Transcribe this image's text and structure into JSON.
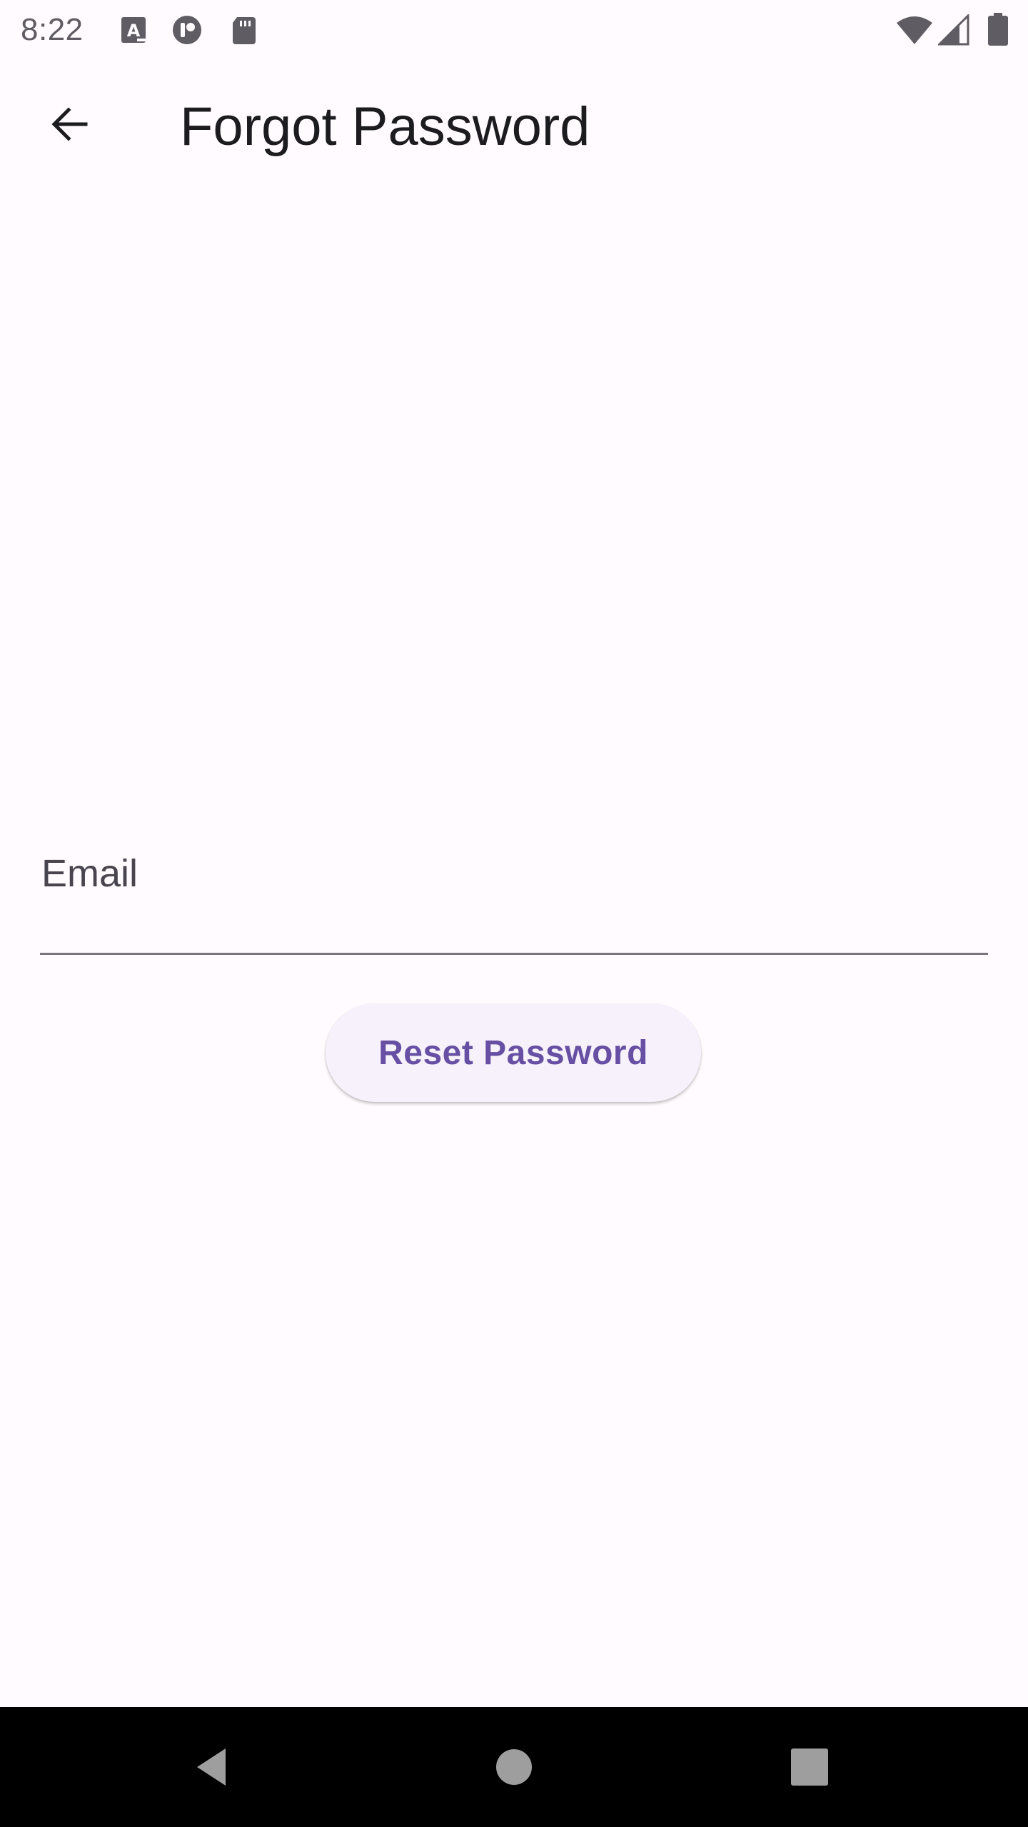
{
  "status_bar": {
    "time": "8:22",
    "left_icons": [
      "font-notification-icon",
      "app-notification-icon",
      "sd-card-icon"
    ],
    "right_icons": [
      "wifi-icon",
      "cell-signal-icon",
      "battery-icon"
    ]
  },
  "app_bar": {
    "back_icon": "arrow-back-icon",
    "title": "Forgot Password"
  },
  "form": {
    "email_label": "Email",
    "email_value": "",
    "reset_button_label": "Reset Password"
  },
  "nav_bar": {
    "icons": [
      "nav-back-icon",
      "nav-home-icon",
      "nav-recents-icon"
    ]
  },
  "colors": {
    "background": "#fffbfe",
    "accent": "#6750a4",
    "button_background": "#f6f1fa",
    "nav_bar": "#000000"
  }
}
